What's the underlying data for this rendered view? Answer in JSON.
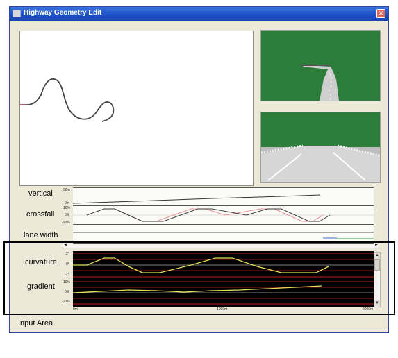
{
  "window": {
    "title": "Highway Geometry Edit",
    "close_glyph": "✕"
  },
  "labels": {
    "vertical": "vertical",
    "crossfall": "crossfall",
    "lane_width": "lane width",
    "curvature": "curvature",
    "gradient": "gradient",
    "input_area": "Input Area"
  },
  "ticks": {
    "vertical_top": "50m",
    "vertical_bottom": "0m",
    "crossfall_top": "10%",
    "crossfall_mid": "0%",
    "crossfall_bottom": "-10%",
    "curvature_top": "2°",
    "curvature_mid": "0°",
    "curvature_bottom": "-2°",
    "gradient_top": "10%",
    "gradient_mid": "0%",
    "gradient_bottom": "-10%",
    "x_start": "0m",
    "x_mid": "1000m",
    "x_end": "2000m"
  },
  "colors": {
    "graph_background": "#000000",
    "grid_red": "#c81e1e",
    "curve_yellow": "#e6e05a",
    "crossfall_left": "#3a3a3a",
    "crossfall_right": "#e89090",
    "grass": "#2c7d3a",
    "annotation_frame": "#000000"
  },
  "icons": {
    "scroll_up": "▲",
    "scroll_down": "▼",
    "scroll_left": "◄",
    "scroll_right": "►"
  }
}
